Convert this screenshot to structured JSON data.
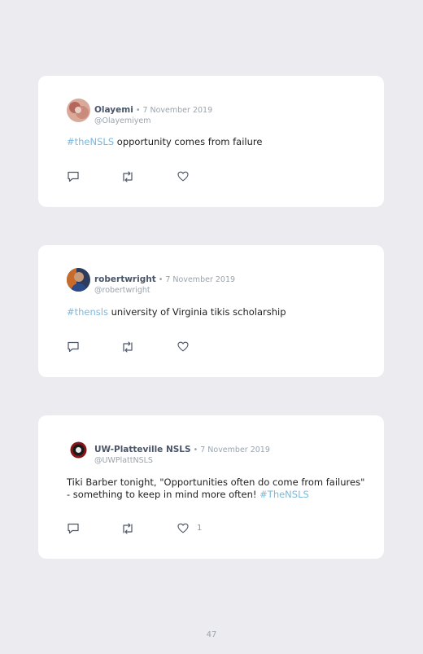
{
  "tweets": [
    {
      "name": "Olayemi",
      "date": " • 7 November 2019",
      "handle": "@Olayemiyem",
      "hashtag_lead": "#theNSLS",
      "text": " opportunity comes from failure",
      "text_before": "",
      "hashtag_trail": "",
      "likes": ""
    },
    {
      "name": "robertwright",
      "date": " • 7 November 2019",
      "handle": "@robertwright",
      "hashtag_lead": "#thensls",
      "text": " university of Virginia tikis scholarship",
      "text_before": "",
      "hashtag_trail": "",
      "likes": ""
    },
    {
      "name": "UW-Platteville NSLS",
      "date": " • 7 November 2019",
      "handle": "@UWPlattNSLS",
      "hashtag_lead": "",
      "text": "",
      "text_before": "Tiki Barber tonight, \"Opportunities often do come from failures\" - something to keep in mind more often! ",
      "hashtag_trail": "#TheNSLS",
      "likes": "1"
    }
  ],
  "icons": {
    "reply": "reply-icon",
    "retweet": "retweet-icon",
    "like": "heart-icon"
  },
  "page_number": "47"
}
